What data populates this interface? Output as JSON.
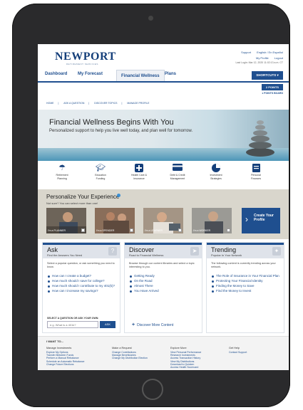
{
  "brand": {
    "logo": "NEWPORT",
    "tagline": "RETIREMENT SERVICES"
  },
  "top_links": {
    "support": "Support",
    "language": "English / En Español",
    "profile": "My Profile",
    "logout": "Logout",
    "last_login": "Last Login: Mar 12, 2020 11:02:13 a.m. CT"
  },
  "nav": {
    "tabs": [
      "Dashboard",
      "My Forecast",
      "Financial Wellness",
      "Plans"
    ],
    "shortcuts": "SHORTCUTS ▾"
  },
  "points": {
    "badge": "2 POINTS",
    "board": "POINTS BOARD"
  },
  "breadcrumbs": [
    "HOME",
    "ASK A QUESTION",
    "DISCOVER TOPICS",
    "MANAGE PROFILE"
  ],
  "hero": {
    "title": "Financial Wellness Begins With You",
    "subtitle": "Personalized support to help you live well today, and plan well for tomorrow."
  },
  "categories": [
    {
      "label1": "Retirement",
      "label2": "Planning",
      "icon": "umbrella-icon"
    },
    {
      "label1": "Education",
      "label2": "Funding",
      "icon": "graduation-cap-icon"
    },
    {
      "label1": "Health Care &",
      "label2": "Insurance",
      "icon": "medical-cross-icon"
    },
    {
      "label1": "Debt & Credit",
      "label2": "Management",
      "icon": "credit-card-icon"
    },
    {
      "label1": "Investment",
      "label2": "Strategies",
      "icon": "pie-chart-icon"
    },
    {
      "label1": "Personal",
      "label2": "Finances",
      "icon": "notebook-icon"
    }
  ],
  "personalize": {
    "title": "Personalize Your Experience",
    "subtitle": "Not sure? You can select more than one!",
    "cards": [
      "I'm a PLANNER",
      "I'm a SPENDER",
      "I'm a LEARNER",
      "I'm a WORKER"
    ],
    "create_label": "Create Your Profile"
  },
  "ask": {
    "title": "Ask",
    "subtitle": "Find the Answers You Need",
    "body": "Select a popular question, or ask something you need to know.",
    "questions": [
      "How can I create a budget?",
      "How much should I save for college?",
      "How much should I contribute to my 401(k)?",
      "How can I increase my savings?"
    ],
    "select_label": "SELECT A QUESTION OR ASK YOUR OWN:",
    "input_placeholder": "e.g. What is a 401k?",
    "button": "ASK"
  },
  "discover": {
    "title": "Discover",
    "subtitle": "Road to Financial Wellness",
    "body": "Browse through our content libraries and select a topic interesting to you.",
    "topics": [
      "Getting Ready",
      "On the Road",
      "Almost There",
      "You Have Arrived"
    ],
    "more": "Discover More Content"
  },
  "trending": {
    "title": "Trending",
    "subtitle": "Popular In Your Network",
    "body": "The following content is currently trending across your network.",
    "items": [
      "The Role of Insurance in Your Financial Plan",
      "Protecting Your Financial Identity",
      "Finding the Money to Save",
      "Find the Money to Invest"
    ]
  },
  "footer": {
    "heading": "I WANT TO...",
    "columns": [
      {
        "title": "Manage Investments",
        "links": [
          "Explore My Options",
          "Transfer Between Funds",
          "Perform a Manual Rebalance",
          "Schedule an Automatic Rebalance",
          "Change Future Elections"
        ]
      },
      {
        "title": "Make a Request",
        "links": [
          "Change Contributions",
          "Manage Beneficiaries",
          "Change My Distribution Election"
        ]
      },
      {
        "title": "Explore More",
        "links": [
          "View Personal Performance",
          "Research Investments",
          "Access Transaction History",
          "View My Distributions",
          "Download to Quicken",
          "Access Health Scorecard"
        ]
      },
      {
        "title": "Get Help",
        "links": [
          "Contact Support"
        ]
      }
    ]
  }
}
